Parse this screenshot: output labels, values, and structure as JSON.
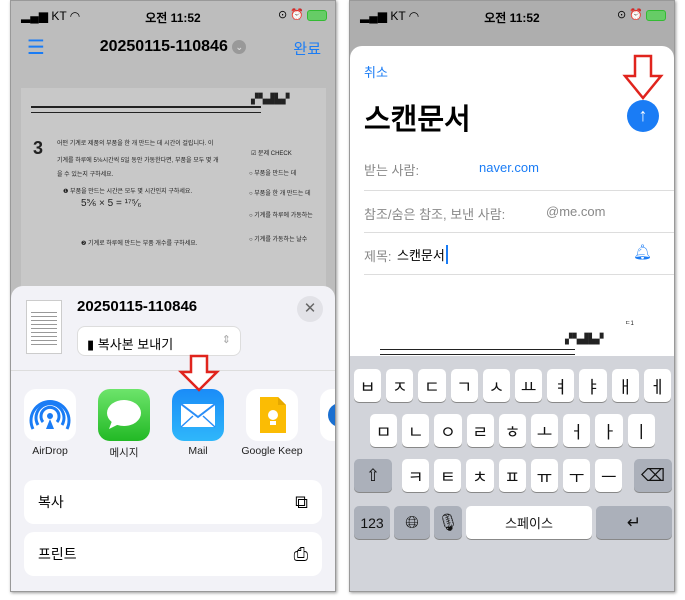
{
  "status": {
    "carrier": "KT",
    "time": "오전 11:52"
  },
  "left": {
    "nav": {
      "title": "20250115-110846",
      "done": "완료"
    },
    "share": {
      "filename": "20250115-110846",
      "option": "복사본 보내기",
      "apps": [
        {
          "label": "AirDrop"
        },
        {
          "label": "메시지"
        },
        {
          "label": "Mail"
        },
        {
          "label": "Google Keep"
        }
      ],
      "actions": [
        {
          "label": "복사"
        },
        {
          "label": "프린트"
        }
      ]
    }
  },
  "right": {
    "mail": {
      "cancel": "취소",
      "title": "스캔문서",
      "to_label": "받는 사람:",
      "to_value": "naver.com",
      "cc_label": "참조/숨은 참조, 보낸 사람:",
      "cc_value": "@me.com",
      "subject_label": "제목:",
      "subject_value": "스캔문서"
    },
    "keyboard": {
      "row1": [
        "ㅂ",
        "ㅈ",
        "ㄷ",
        "ㄱ",
        "ㅅ",
        "ㅛ",
        "ㅕ",
        "ㅑ",
        "ㅐ",
        "ㅔ"
      ],
      "row2": [
        "ㅁ",
        "ㄴ",
        "ㅇ",
        "ㄹ",
        "ㅎ",
        "ㅗ",
        "ㅓ",
        "ㅏ",
        "ㅣ"
      ],
      "row3": [
        "ㅋ",
        "ㅌ",
        "ㅊ",
        "ㅍ",
        "ㅠ",
        "ㅜ",
        "ㅡ"
      ],
      "numbers": "123",
      "space": "스페이스"
    }
  },
  "colors": {
    "accent": "#1a7cf5",
    "arrow": "#e0241d"
  }
}
